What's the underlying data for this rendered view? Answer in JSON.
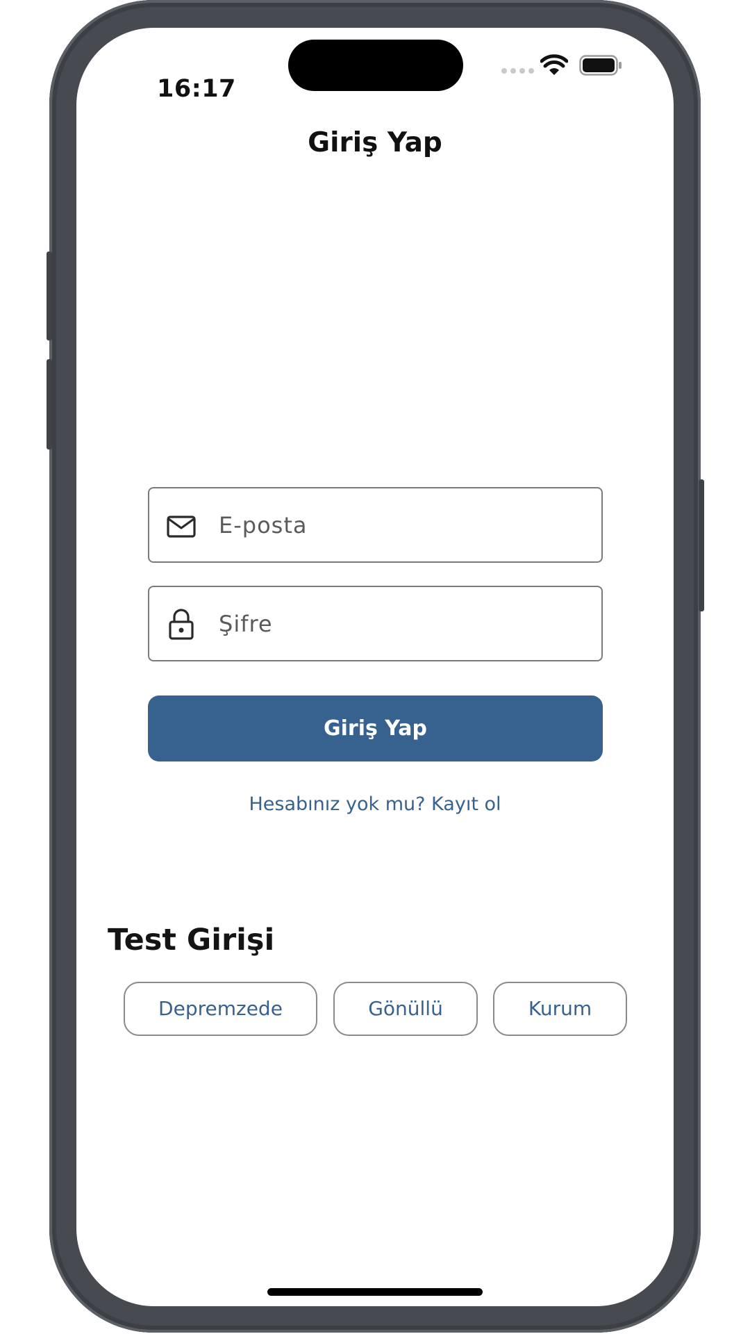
{
  "status_bar": {
    "time": "16:17",
    "wifi_icon": "wifi-icon",
    "battery_icon": "battery-icon"
  },
  "header": {
    "title": "Giriş Yap"
  },
  "form": {
    "email": {
      "placeholder": "E-posta",
      "value": "",
      "icon": "mail-icon"
    },
    "password": {
      "placeholder": "Şifre",
      "value": "",
      "icon": "lock-icon"
    },
    "submit_label": "Giriş Yap",
    "register_link": "Hesabınız yok mu? Kayıt ol"
  },
  "test_login": {
    "title": "Test Girişi",
    "buttons": [
      {
        "label": "Depremzede"
      },
      {
        "label": "Gönüllü"
      },
      {
        "label": "Kurum"
      }
    ]
  },
  "colors": {
    "accent": "#37628f",
    "device_frame": "#474a50",
    "text": "#111111"
  }
}
